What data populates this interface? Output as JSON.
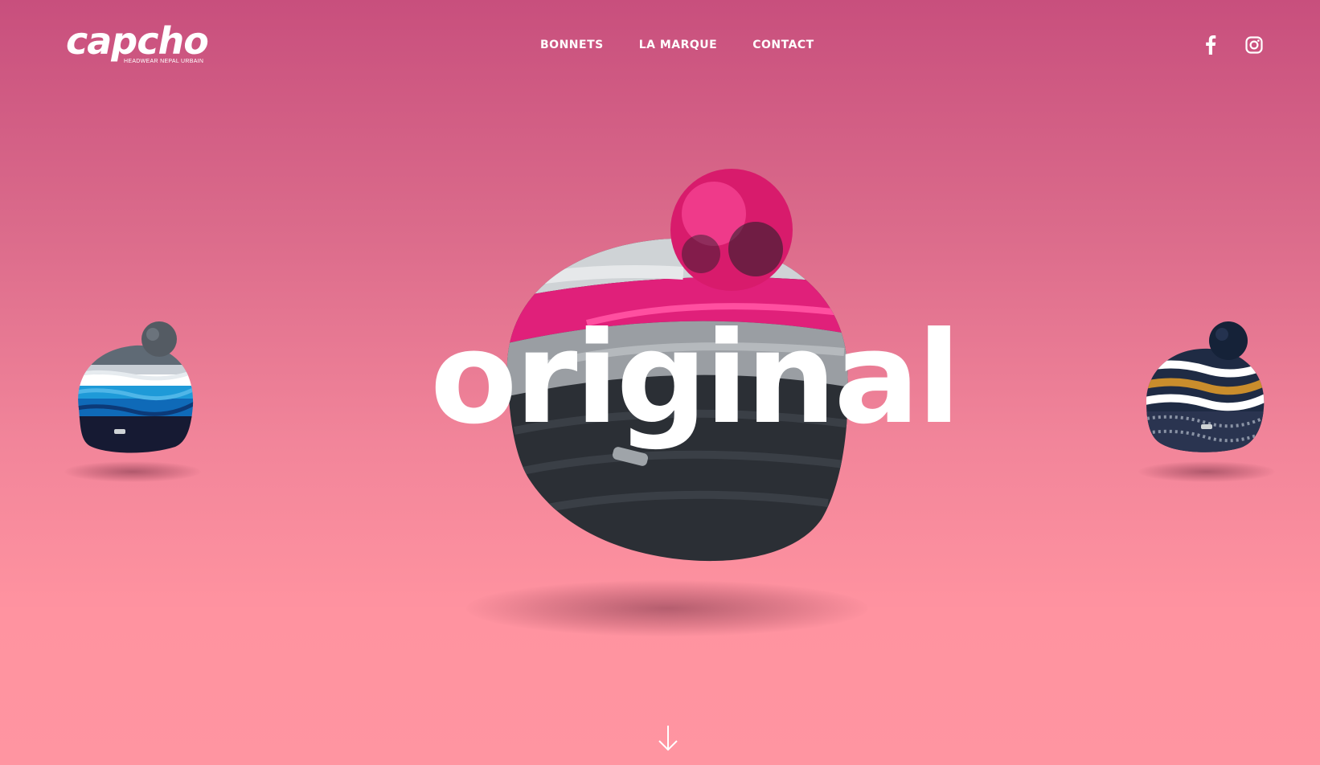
{
  "brand": {
    "logo_text": "capcho",
    "tagline": "HEADWEAR NEPAL URBAIN"
  },
  "nav": {
    "items": [
      {
        "label": "BONNETS"
      },
      {
        "label": "LA MARQUE"
      },
      {
        "label": "CONTACT"
      }
    ]
  },
  "social": {
    "facebook_icon": "facebook-icon",
    "instagram_icon": "instagram-icon"
  },
  "hero": {
    "word": "original",
    "scroll_icon": "arrow-down-icon",
    "products": [
      {
        "name": "hat-blue-white-stripes",
        "colors": [
          "#5f6a75",
          "#c9cfd6",
          "#ffffff",
          "#1e9ad8",
          "#0f4d9a",
          "#161a33"
        ]
      },
      {
        "name": "hat-pink-grey-black",
        "colors": [
          "#e0207a",
          "#9a9ea3",
          "#cfd3d6",
          "#2b2f35"
        ]
      },
      {
        "name": "hat-navy-mustard-stripes",
        "colors": [
          "#152238",
          "#ffffff",
          "#c98d2c",
          "#1f2b44"
        ]
      }
    ]
  },
  "colors": {
    "background_top": "#c84f7d",
    "background_bottom": "#ff95a1",
    "text": "#ffffff"
  }
}
